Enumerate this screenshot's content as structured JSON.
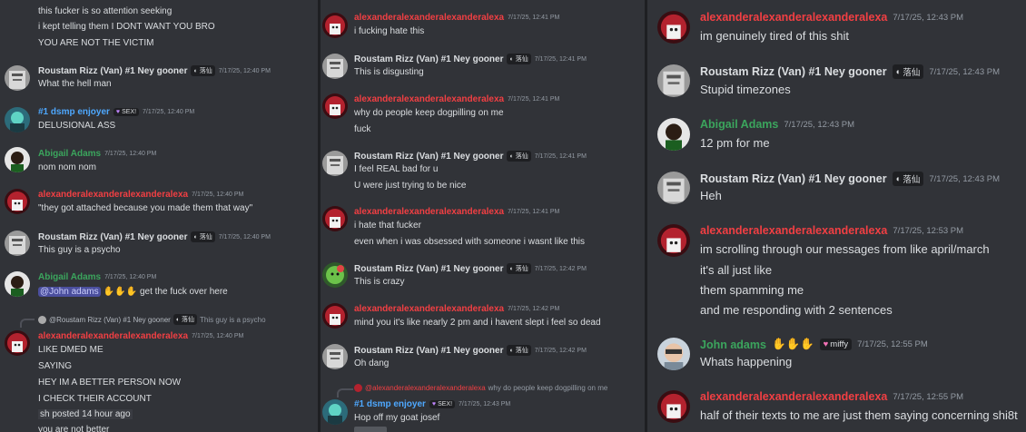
{
  "users": {
    "alex": {
      "name": "alexanderalexanderalexanderalexa",
      "color": "#f23f43"
    },
    "roustam": {
      "name": "Roustam Rizz (Van) #1 Ney gooner",
      "color": "#dbdee1",
      "tag": "落仙"
    },
    "dsmp": {
      "name": "#1 dsmp enjoyer",
      "color": "#4ea8ff",
      "tag": "SEX!"
    },
    "abigail": {
      "name": "Abigail Adams",
      "color": "#3ba55d"
    },
    "john": {
      "name": "John adams",
      "color": "#3ba55d",
      "tag": "miffy"
    }
  },
  "p1": {
    "top_lines": [
      "this fucker is so attention seeking",
      "i kept telling them I DONT WANT YOU BRO",
      "YOU ARE NOT THE VICTIM"
    ],
    "m1": {
      "ts": "7/17/25, 12:40 PM",
      "text": "What the hell man"
    },
    "m2": {
      "ts": "7/17/25, 12:40 PM",
      "text": "DELUSIONAL ASS"
    },
    "m3": {
      "ts": "7/17/25, 12:40 PM",
      "text": "nom nom nom"
    },
    "m4": {
      "ts": "7/17/25, 12:40 PM",
      "text": "\"they got attached because you made them that way\""
    },
    "m5": {
      "ts": "7/17/25, 12:40 PM",
      "text": "This guy is a psycho"
    },
    "m6": {
      "ts": "7/17/25, 12:40 PM",
      "mention": "@John adams",
      "after": "get the fuck over here"
    },
    "reply": {
      "user": "@Roustam Rizz (Van) #1 Ney gooner",
      "tag": "落仙",
      "text": "This guy is a psycho"
    },
    "m7": {
      "ts": "7/17/25, 12:40 PM",
      "lines": [
        "LIKE DMED ME",
        "SAYING",
        "HEY IM A BETTER PERSON NOW",
        "I CHECK THEIR ACCOUNT"
      ],
      "posted": "sh posted 14 hour ago",
      "last": "you are not better"
    }
  },
  "p2": {
    "m1": {
      "ts": "7/17/25, 12:41 PM",
      "text": "i fucking hate this"
    },
    "m2": {
      "ts": "7/17/25, 12:41 PM",
      "text": "This is disgusting"
    },
    "m3": {
      "ts": "7/17/25, 12:41 PM",
      "lines": [
        "why do people keep dogpilling on me",
        "fuck"
      ]
    },
    "m4": {
      "ts": "7/17/25, 12:41 PM",
      "lines": [
        "I feel REAL bad for u",
        "U were just trying to be nice"
      ]
    },
    "m5": {
      "ts": "7/17/25, 12:41 PM",
      "lines": [
        "i hate that fucker",
        "even when i was obsessed with someone i wasnt like this"
      ]
    },
    "m6": {
      "ts": "7/17/25, 12:42 PM",
      "text": "This is crazy"
    },
    "m7": {
      "ts": "7/17/25, 12:42 PM",
      "text": "mind you it's like nearly 2 pm and i havent slept i feel so dead"
    },
    "m8": {
      "ts": "7/17/25, 12:42 PM",
      "text": "Oh dang"
    },
    "reply": {
      "user": "@alexanderalexanderalexanderalexa",
      "text": "why do people keep dogpilling on me"
    },
    "m9": {
      "ts": "7/17/25, 12:43 PM",
      "text": "Hop off my goat josef"
    }
  },
  "p3": {
    "m1": {
      "ts": "7/17/25, 12:43 PM",
      "text": "im genuinely tired of this shit"
    },
    "m2": {
      "ts": "7/17/25, 12:43 PM",
      "text": "Stupid timezones"
    },
    "m3": {
      "ts": "7/17/25, 12:43 PM",
      "text": "12 pm for me"
    },
    "m4": {
      "ts": "7/17/25, 12:43 PM",
      "text": "Heh"
    },
    "m5": {
      "ts": "7/17/25, 12:53 PM",
      "lines": [
        "im scrolling through our messages from like april/march",
        "it's all just like",
        "them spamming me",
        "and me responding with 2 sentences"
      ]
    },
    "m6": {
      "ts": "7/17/25, 12:55 PM",
      "text": "Whats happening"
    },
    "m7": {
      "ts": "7/17/25, 12:55 PM",
      "text": "half of their texts to me are just them saying concerning shi8t"
    }
  }
}
